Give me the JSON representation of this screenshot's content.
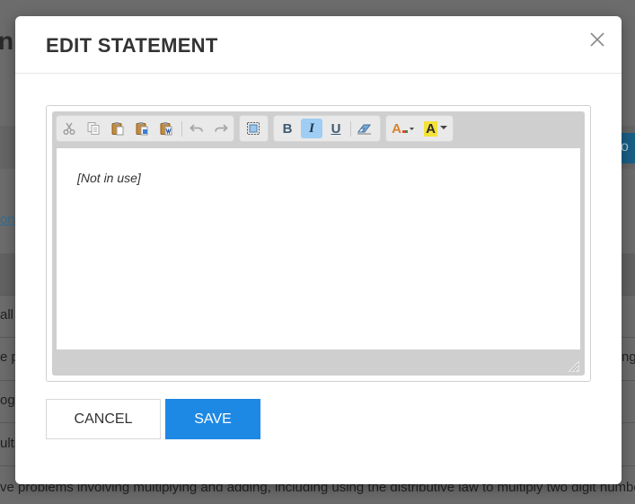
{
  "background": {
    "title_fragment": "n",
    "blue_tab_fragment": "o",
    "link_fragment": "ono",
    "rows": [
      "all",
      "e pl",
      "og",
      "ultip"
    ],
    "right_fragment": "ng",
    "bottom_text": "ve problems involving multiplying and adding, including using the distributive law to multiply two digit numbers"
  },
  "modal": {
    "title": "EDIT STATEMENT",
    "close_icon": "close-icon",
    "editor": {
      "toolbar": {
        "clipboard": [
          "cut-icon",
          "copy-icon",
          "paste-icon",
          "paste-text-icon",
          "paste-word-icon"
        ],
        "history": [
          "undo-icon",
          "redo-icon"
        ],
        "tools": [
          "select-all-icon"
        ],
        "formatting": [
          {
            "label": "B",
            "icon": "bold-icon",
            "active": false
          },
          {
            "label": "I",
            "icon": "italic-icon",
            "active": true
          },
          {
            "label": "U",
            "icon": "underline-icon",
            "active": false
          }
        ],
        "eraser": "remove-format-icon",
        "colors": [
          {
            "label": "A",
            "icon": "text-color-icon"
          },
          {
            "label": "A",
            "icon": "background-color-icon"
          }
        ]
      },
      "content": "[Not in use]"
    },
    "buttons": {
      "cancel": "CANCEL",
      "save": "SAVE"
    },
    "colors": {
      "save_bg": "#1e88e5",
      "active_button": "#9fcdf3",
      "highlight_yellow": "#f3e23a"
    }
  }
}
